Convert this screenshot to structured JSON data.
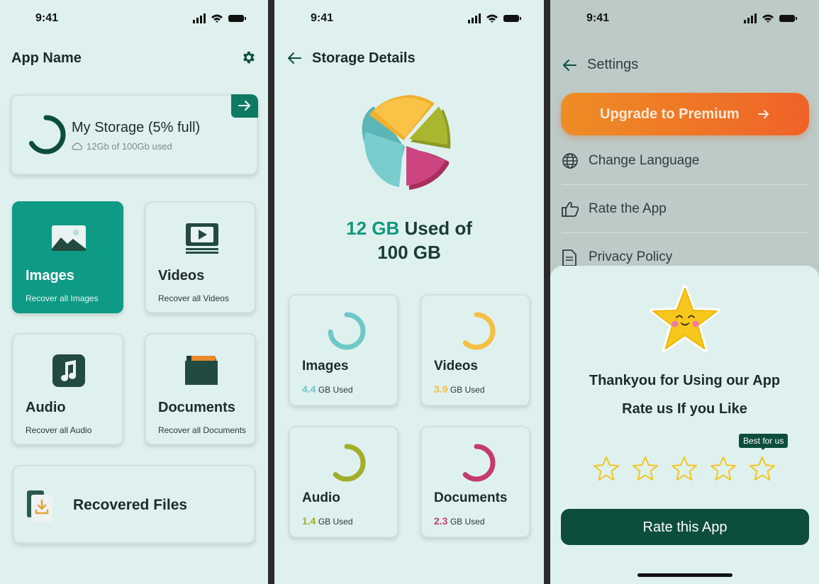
{
  "status": {
    "time": "9:41"
  },
  "home": {
    "app_name": "App Name",
    "storage": {
      "title": "My Storage (5% full)",
      "subtitle": "12Gb of 100Gb used"
    },
    "tiles": [
      {
        "title": "Images",
        "subtitle": "Recover all Images"
      },
      {
        "title": "Videos",
        "subtitle": "Recover all Videos"
      },
      {
        "title": "Audio",
        "subtitle": "Recover all Audio"
      },
      {
        "title": "Documents",
        "subtitle": "Recover all Documents"
      }
    ],
    "recovered": "Recovered Files"
  },
  "storage_details": {
    "title": "Storage Details",
    "used_value": "12 GB",
    "used_text": "Used of",
    "total": "100 GB",
    "items": [
      {
        "title": "Images",
        "value": "4.4",
        "unit": "GB Used",
        "color": "#6fc8c8",
        "fraction": 0.74
      },
      {
        "title": "Videos",
        "value": "3.9",
        "unit": "GB Used",
        "color": "#f5c043",
        "fraction": 0.62
      },
      {
        "title": "Audio",
        "value": "1.4",
        "unit": "GB Used",
        "color": "#a2ae2a",
        "fraction": 0.62
      },
      {
        "title": "Documents",
        "value": "2.3",
        "unit": "GB Used",
        "color": "#c43a71",
        "fraction": 0.62
      }
    ]
  },
  "settings": {
    "title": "Settings",
    "premium": "Upgrade to Premium",
    "menu": [
      "Change Language",
      "Rate the App",
      "Privacy Policy"
    ],
    "sheet": {
      "line1": "Thankyou for Using our App",
      "line2": "Rate us If you Like",
      "tooltip": "Best for us",
      "rating_max": 5,
      "button": "Rate this App"
    }
  },
  "colors": {
    "brand_dark": "#0d4d3d",
    "brand_teal": "#0e9b86",
    "premium_orange": "#f1781f"
  }
}
